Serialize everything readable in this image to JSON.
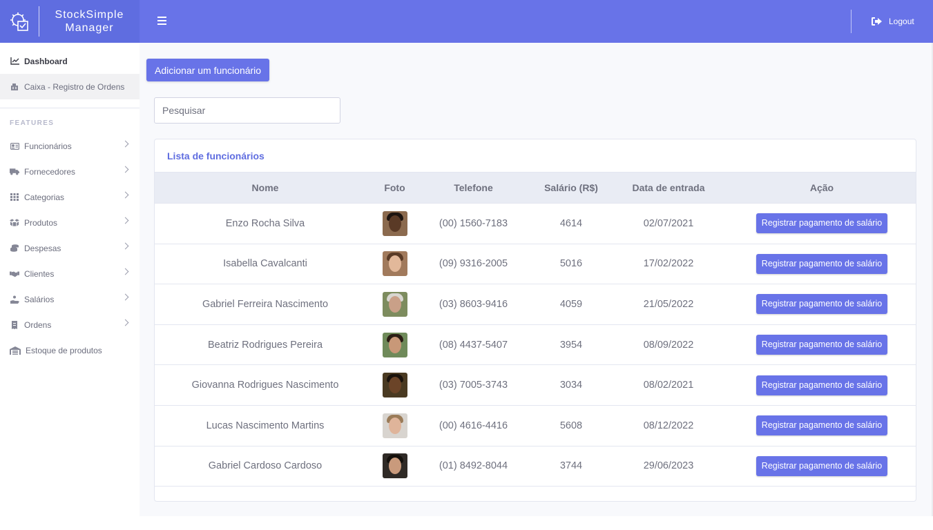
{
  "brand": {
    "line1": "StockSimple",
    "line2": "Manager",
    "icon": "gear-check-icon"
  },
  "sidebar": {
    "top_items": [
      {
        "label": "Dashboard",
        "icon": "chart-line-icon"
      },
      {
        "label": "Caixa - Registro de Ordens",
        "icon": "cash-register-icon"
      }
    ],
    "heading": "FEATURES",
    "items": [
      {
        "label": "Funcionários",
        "icon": "id-card-icon"
      },
      {
        "label": "Fornecedores",
        "icon": "truck-icon"
      },
      {
        "label": "Categorias",
        "icon": "grid-icon"
      },
      {
        "label": "Produtos",
        "icon": "boxes-icon"
      },
      {
        "label": "Despesas",
        "icon": "coins-icon"
      },
      {
        "label": "Clientes",
        "icon": "handshake-icon"
      },
      {
        "label": "Salários",
        "icon": "hand-coin-icon"
      },
      {
        "label": "Ordens",
        "icon": "receipt-icon"
      },
      {
        "label": "Estoque de produtos",
        "icon": "warehouse-icon"
      }
    ]
  },
  "topbar": {
    "logout_label": "Logout"
  },
  "main": {
    "add_button": "Adicionar um funcionário",
    "search_placeholder": "Pesquisar",
    "card_title": "Lista de funcionários",
    "columns": [
      "Nome",
      "Foto",
      "Telefone",
      "Salário (R$)",
      "Data de entrada",
      "Ação"
    ],
    "action_label": "Registrar pagamento de salário",
    "rows": [
      {
        "nome": "Enzo Rocha Silva",
        "telefone": "(00) 1560-7183",
        "salario": "4614",
        "data": "02/07/2021"
      },
      {
        "nome": "Isabella Cavalcanti",
        "telefone": "(09) 9316-2005",
        "salario": "5016",
        "data": "17/02/2022"
      },
      {
        "nome": "Gabriel Ferreira Nascimento",
        "telefone": "(03) 8603-9416",
        "salario": "4059",
        "data": "21/05/2022"
      },
      {
        "nome": "Beatriz Rodrigues Pereira",
        "telefone": "(08) 4437-5407",
        "salario": "3954",
        "data": "08/09/2022"
      },
      {
        "nome": "Giovanna Rodrigues Nascimento",
        "telefone": "(03) 7005-3743",
        "salario": "3034",
        "data": "08/02/2021"
      },
      {
        "nome": "Lucas Nascimento Martins",
        "telefone": "(00) 4616-4416",
        "salario": "5608",
        "data": "08/12/2022"
      },
      {
        "nome": "Gabriel Cardoso Cardoso",
        "telefone": "(01) 8492-8044",
        "salario": "3744",
        "data": "29/06/2023"
      }
    ]
  },
  "colors": {
    "primary": "#6873e8",
    "brand": "#5f6de0",
    "text": "#6e707e"
  }
}
